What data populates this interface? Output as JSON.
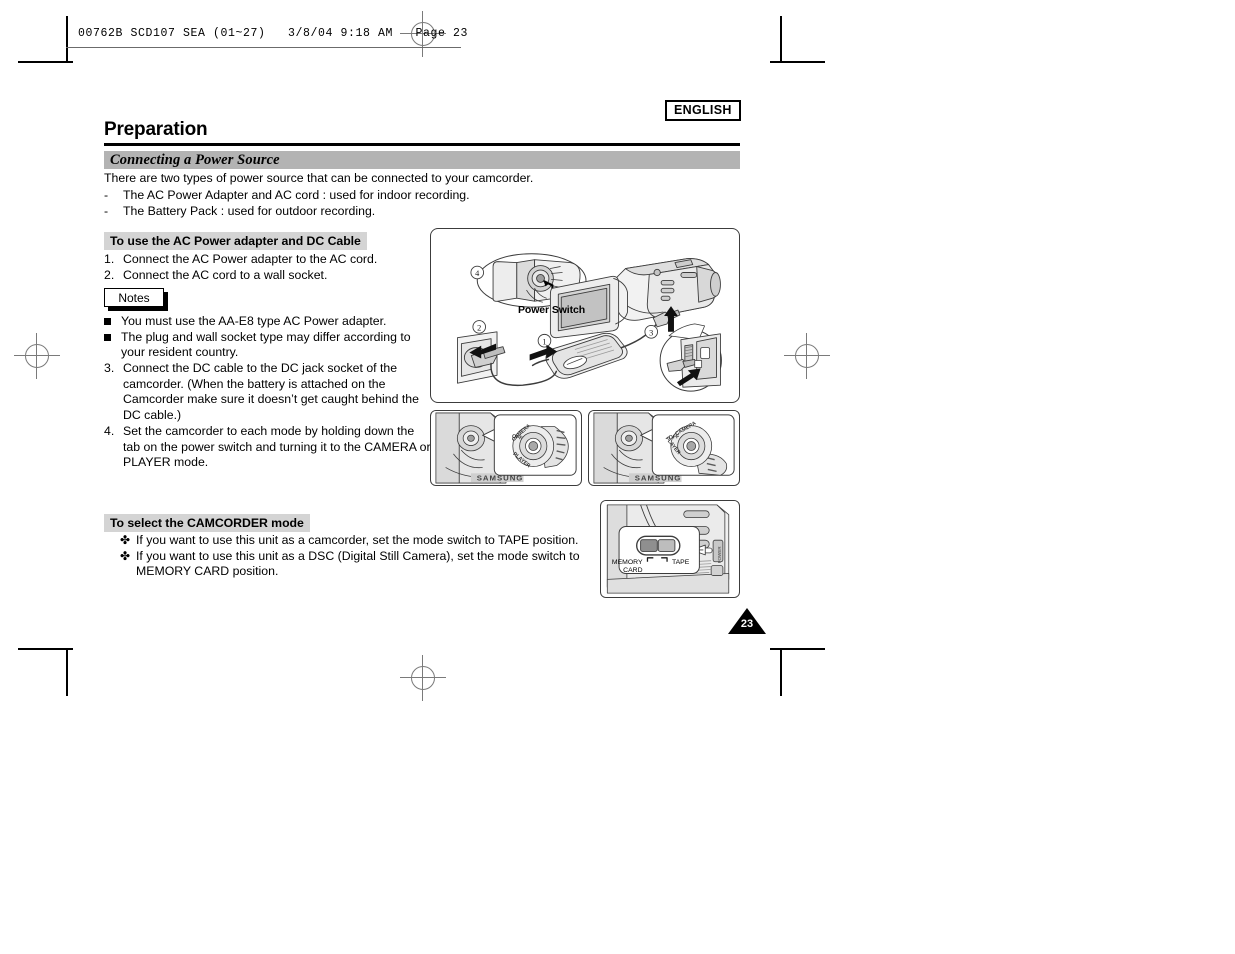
{
  "file_header": {
    "text": "00762B SCD107 SEA (01~27)   3/8/04 9:18 AM   Page 23"
  },
  "page": {
    "language_badge": "ENGLISH",
    "title": "Preparation",
    "page_number": "23"
  },
  "section": {
    "bar_title": "Connecting a Power Source",
    "intro_line": "There are two types of power source that can be connected to your camcorder.",
    "dash_items": [
      {
        "mark": "-",
        "text": "The AC Power Adapter and AC cord : used for indoor recording."
      },
      {
        "mark": "-",
        "text": "The Battery Pack : used for outdoor recording."
      }
    ]
  },
  "ac_power": {
    "heading": "To use the AC Power adapter and DC Cable",
    "steps_top": [
      {
        "n": "1.",
        "text": "Connect the AC Power adapter to the AC cord."
      },
      {
        "n": "2.",
        "text": "Connect the AC cord to a wall socket."
      }
    ],
    "notes_label": "Notes",
    "notes": [
      "You must use the AA-E8 type AC Power adapter.",
      "The plug and wall socket type may differ according to your resident country."
    ],
    "steps_bottom": [
      {
        "n": "3.",
        "text": "Connect the DC cable to the DC jack socket of the camcorder. (When the battery is attached on the Camcorder make sure it doesn’t get caught behind the DC cable.)"
      },
      {
        "n": "4.",
        "text": "Set the camcorder to each mode by holding down the tab on the power switch and turning it to the CAMERA or PLAYER mode."
      }
    ]
  },
  "camcorder_mode": {
    "heading": "To select the CAMCORDER mode",
    "bullet_glyph": "✤",
    "items": [
      "If you want to use this unit as a camcorder, set the mode switch to TAPE position.",
      "If you want to use this unit as a DSC (Digital Still Camera), set the mode switch to MEMORY CARD position."
    ]
  },
  "figures": {
    "main": {
      "callout_label": "Power Switch",
      "step_markers": [
        "①",
        "②",
        "③",
        "④"
      ]
    },
    "dial_inset_left": {
      "labels": [
        "CAMERA",
        "OFF",
        "PLAYER"
      ]
    },
    "dial_inset_right": {
      "labels": [
        "CAMERA",
        "OFF",
        "PLAYER"
      ]
    },
    "mode_switch": {
      "left_label_line1": "MEMORY",
      "left_label_line2": "CARD",
      "right_label": "TAPE",
      "left_arrow": "⌐",
      "right_arrow": "¬"
    }
  },
  "colors": {
    "section_bar": "#b3b3b3",
    "subhead_bar": "#d4d4d4",
    "illustration_line": "#3c3c3c",
    "shade_light": "#e8e8e8",
    "shade_mid": "#c9c9c9",
    "shade_dark": "#a5a5a5"
  }
}
